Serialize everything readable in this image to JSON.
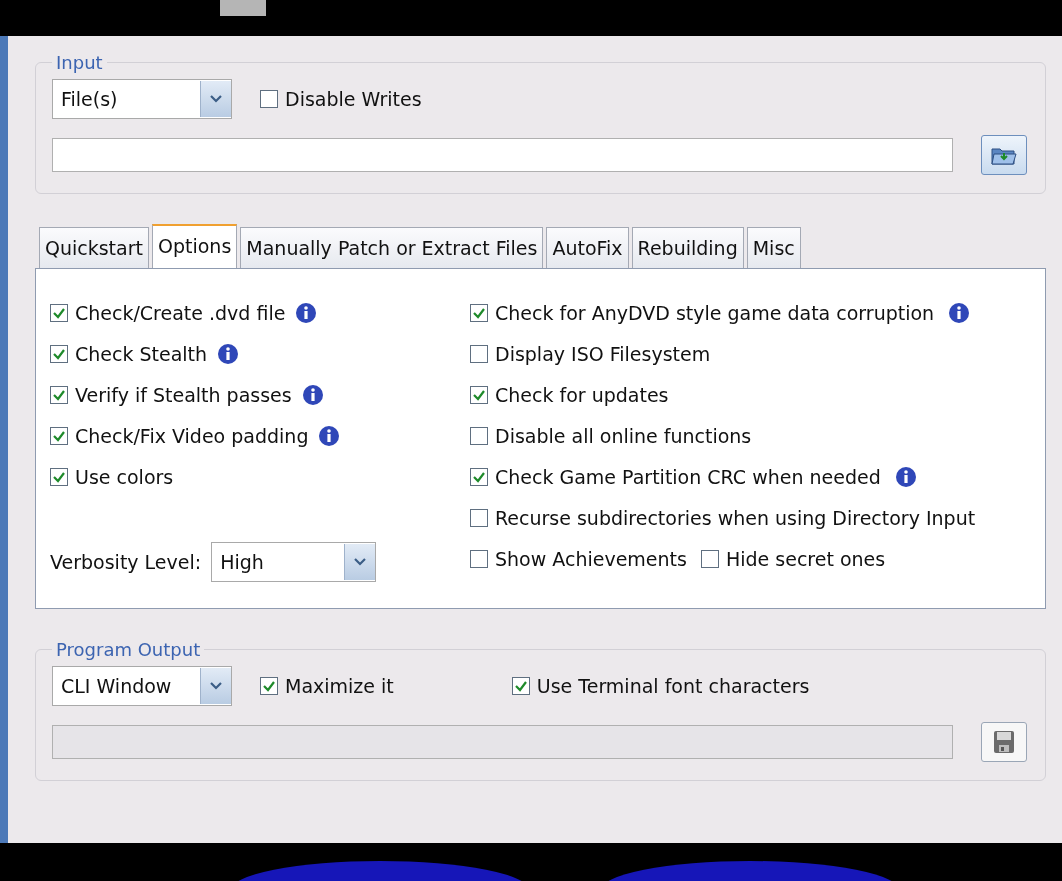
{
  "input": {
    "title": "Input",
    "source": "File(s)",
    "disable_writes": {
      "label": "Disable Writes",
      "checked": false
    }
  },
  "tabs": [
    {
      "label": "Quickstart",
      "selected": false
    },
    {
      "label": "Options",
      "selected": true
    },
    {
      "label": "Manually Patch or Extract Files",
      "selected": false
    },
    {
      "label": "AutoFix",
      "selected": false
    },
    {
      "label": "Rebuilding",
      "selected": false
    },
    {
      "label": "Misc",
      "selected": false
    }
  ],
  "left_options": [
    {
      "label": "Check/Create .dvd file",
      "checked": true,
      "info": true
    },
    {
      "label": "Check Stealth",
      "checked": true,
      "info": true
    },
    {
      "label": "Verify if Stealth passes",
      "checked": true,
      "info": true
    },
    {
      "label": "Check/Fix Video padding",
      "checked": true,
      "info": true
    },
    {
      "label": "Use colors",
      "checked": true,
      "info": false
    }
  ],
  "verbosity": {
    "label": "Verbosity Level:",
    "value": "High"
  },
  "right_rows": [
    {
      "options": [
        {
          "label": "Check for AnyDVD style game data corruption",
          "checked": true,
          "info": true
        }
      ]
    },
    {
      "options": [
        {
          "label": "Display ISO Filesystem",
          "checked": false,
          "info": false
        }
      ]
    },
    {
      "options": [
        {
          "label": "Check for updates",
          "checked": true,
          "info": false
        }
      ]
    },
    {
      "options": [
        {
          "label": "Disable all online functions",
          "checked": false,
          "info": false
        }
      ]
    },
    {
      "options": [
        {
          "label": "Check Game Partition CRC when needed",
          "checked": true,
          "info": true
        }
      ]
    },
    {
      "options": [
        {
          "label": "Recurse subdirectories when using Directory Input",
          "checked": false,
          "info": false
        }
      ]
    },
    {
      "options": [
        {
          "label": "Show Achievements",
          "checked": false,
          "info": false
        },
        {
          "label": "Hide secret ones",
          "checked": false,
          "info": false
        }
      ]
    }
  ],
  "output": {
    "title": "Program Output",
    "target": "CLI Window",
    "maximize": {
      "label": "Maximize it",
      "checked": true
    },
    "terminal_font": {
      "label": "Use Terminal font characters",
      "checked": true
    }
  }
}
